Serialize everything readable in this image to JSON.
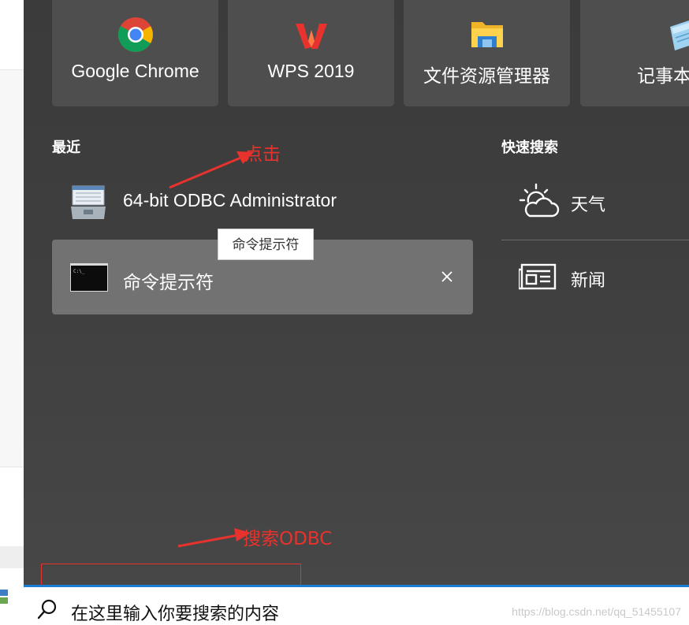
{
  "pinned_tiles": [
    {
      "label": "Google Chrome",
      "icon": "chrome-icon"
    },
    {
      "label": "WPS 2019",
      "icon": "wps-icon"
    },
    {
      "label": "文件资源管理器",
      "icon": "file-explorer-icon"
    },
    {
      "label": "记事本",
      "icon": "notepad-icon"
    }
  ],
  "recent": {
    "title": "最近",
    "items": [
      {
        "label": "64-bit ODBC Administrator",
        "icon": "odbc-admin-icon"
      },
      {
        "label": "命令提示符",
        "icon": "command-prompt-icon"
      }
    ],
    "tooltip": "命令提示符"
  },
  "quick_search": {
    "title": "快速搜索",
    "items": [
      {
        "label": "天气",
        "icon": "weather-icon"
      },
      {
        "label": "新闻",
        "icon": "news-icon"
      }
    ]
  },
  "annotations": {
    "click": "点击",
    "search": "搜索ODBC"
  },
  "search": {
    "text": "在这里输入你要搜索的内容",
    "icon": "search-icon"
  },
  "watermark": "https://blog.csdn.net/qq_51455107",
  "colors": {
    "panel_bg": "#3e3e3e",
    "tile_bg": "#4e4e4e",
    "highlight_row": "#727272",
    "annotation_red": "#e8322d",
    "search_border": "#1a7fd4"
  }
}
